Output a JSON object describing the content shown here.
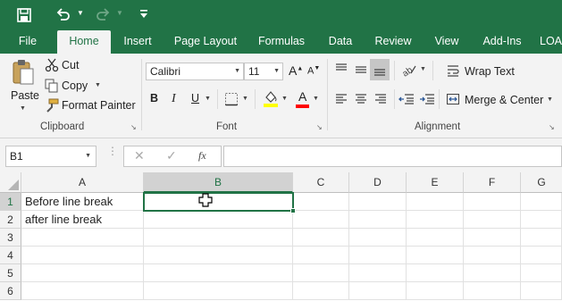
{
  "qat": {
    "icons": [
      "save-icon",
      "undo-icon",
      "redo-icon",
      "customize-icon"
    ]
  },
  "tabs": [
    "File",
    "Home",
    "Insert",
    "Page Layout",
    "Formulas",
    "Data",
    "Review",
    "View",
    "Add-Ins",
    "LOA"
  ],
  "clipboard": {
    "paste": "Paste",
    "cut": "Cut",
    "copy": "Copy",
    "format_painter": "Format Painter",
    "label": "Clipboard"
  },
  "font": {
    "name": "Calibri",
    "size": "11",
    "bold": "B",
    "italic": "I",
    "underline": "U",
    "label": "Font",
    "colors": {
      "highlight": "#ffff00",
      "font_color": "#ff0000"
    }
  },
  "alignment": {
    "wrap_text": "Wrap Text",
    "merge_center": "Merge & Center",
    "label": "Alignment"
  },
  "formula_bar": {
    "name_box": "B1",
    "fx": "fx",
    "content": ""
  },
  "sheet": {
    "columns": [
      "A",
      "B",
      "C",
      "D",
      "E",
      "F",
      "G"
    ],
    "rows": [
      "1",
      "2",
      "3",
      "4",
      "5",
      "6"
    ],
    "cells": {
      "A1": "Before line break",
      "A2": "after line break"
    },
    "selected": "B1"
  },
  "colors": {
    "accent": "#217346",
    "ribbon": "#f3f3f3"
  }
}
